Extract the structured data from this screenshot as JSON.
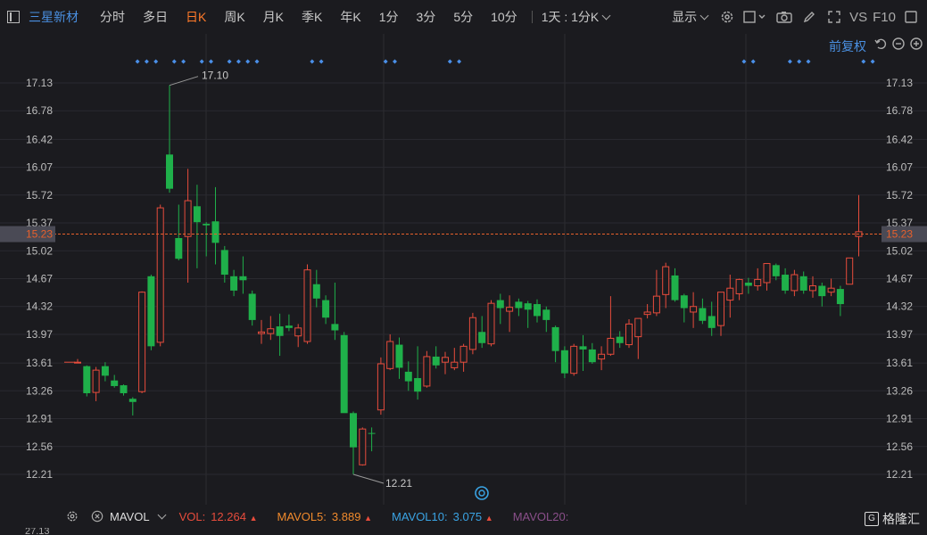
{
  "toolbar": {
    "stock_name": "三星新材",
    "tabs": [
      "分时",
      "多日",
      "日K",
      "周K",
      "月K",
      "季K",
      "年K",
      "1分",
      "3分",
      "5分",
      "10分"
    ],
    "active_tab": "日K",
    "period_select": "1天 : 1分K",
    "display_label": "显示",
    "vs_label": "VS",
    "f10_label": "F10"
  },
  "adjust_label": "前复权",
  "bottom": {
    "indicator": "MAVOL",
    "vol_label": "VOL:",
    "vol_value": "12.264",
    "mavol5_label": "MAVOL5:",
    "mavol5_value": "3.889",
    "mavol10_label": "MAVOL10:",
    "mavol10_value": "3.075",
    "mavol20_label": "MAVOL20:",
    "cut_label": "27.13"
  },
  "brand": "格隆汇",
  "colors": {
    "up": "#e74c3c",
    "down": "#1fb04a",
    "accent": "#ff7a29",
    "link": "#4a90e2",
    "current_price": "#e8602c",
    "mavol5": "#f08a2c",
    "mavol10": "#3aa3e3",
    "mavol20": "#8a4f8a"
  },
  "chart_data": {
    "type": "candlestick",
    "y_ticks": [
      "17.13",
      "16.78",
      "16.42",
      "16.07",
      "15.72",
      "15.37",
      "15.02",
      "14.67",
      "14.32",
      "13.97",
      "13.61",
      "13.26",
      "12.91",
      "12.56",
      "12.21"
    ],
    "ylim": [
      12.06,
      17.43
    ],
    "current_price": "15.23",
    "high_label": "17.10",
    "low_label": "12.21",
    "candles": [
      {
        "o": 13.62,
        "h": 13.66,
        "l": 13.62,
        "c": 13.62
      },
      {
        "o": 13.57,
        "h": 13.58,
        "l": 13.19,
        "c": 13.23
      },
      {
        "o": 13.24,
        "h": 13.56,
        "l": 13.13,
        "c": 13.52
      },
      {
        "o": 13.57,
        "h": 13.62,
        "l": 13.38,
        "c": 13.45
      },
      {
        "o": 13.39,
        "h": 13.46,
        "l": 13.3,
        "c": 13.32
      },
      {
        "o": 13.33,
        "h": 13.34,
        "l": 13.2,
        "c": 13.23
      },
      {
        "o": 13.16,
        "h": 13.18,
        "l": 12.95,
        "c": 13.12
      },
      {
        "o": 13.25,
        "h": 14.51,
        "l": 13.23,
        "c": 14.5
      },
      {
        "o": 14.7,
        "h": 14.72,
        "l": 13.77,
        "c": 13.82
      },
      {
        "o": 13.87,
        "h": 15.6,
        "l": 13.82,
        "c": 15.56
      },
      {
        "o": 16.23,
        "h": 17.1,
        "l": 15.75,
        "c": 15.8
      },
      {
        "o": 15.18,
        "h": 15.6,
        "l": 14.9,
        "c": 14.92
      },
      {
        "o": 15.2,
        "h": 16.05,
        "l": 14.62,
        "c": 15.65
      },
      {
        "o": 15.58,
        "h": 15.85,
        "l": 14.8,
        "c": 15.38
      },
      {
        "o": 15.36,
        "h": 15.38,
        "l": 14.95,
        "c": 15.34
      },
      {
        "o": 15.39,
        "h": 15.82,
        "l": 14.85,
        "c": 15.12
      },
      {
        "o": 15.03,
        "h": 15.08,
        "l": 14.62,
        "c": 14.72
      },
      {
        "o": 14.7,
        "h": 14.78,
        "l": 14.45,
        "c": 14.52
      },
      {
        "o": 14.7,
        "h": 14.95,
        "l": 14.48,
        "c": 14.65
      },
      {
        "o": 14.48,
        "h": 14.52,
        "l": 14.08,
        "c": 14.15
      },
      {
        "o": 13.98,
        "h": 14.15,
        "l": 13.85,
        "c": 14.0
      },
      {
        "o": 13.98,
        "h": 14.2,
        "l": 13.9,
        "c": 14.04
      },
      {
        "o": 14.07,
        "h": 14.23,
        "l": 13.7,
        "c": 13.95
      },
      {
        "o": 14.08,
        "h": 14.22,
        "l": 14.01,
        "c": 14.05
      },
      {
        "o": 13.95,
        "h": 14.1,
        "l": 13.81,
        "c": 14.05
      },
      {
        "o": 13.88,
        "h": 14.85,
        "l": 13.85,
        "c": 14.78
      },
      {
        "o": 14.6,
        "h": 14.78,
        "l": 14.31,
        "c": 14.42
      },
      {
        "o": 14.4,
        "h": 14.46,
        "l": 14.1,
        "c": 14.18
      },
      {
        "o": 14.1,
        "h": 14.62,
        "l": 13.9,
        "c": 14.02
      },
      {
        "o": 13.96,
        "h": 14.0,
        "l": 12.99,
        "c": 12.98
      },
      {
        "o": 12.98,
        "h": 13.0,
        "l": 12.21,
        "c": 12.55
      },
      {
        "o": 12.33,
        "h": 12.8,
        "l": 12.32,
        "c": 12.78
      },
      {
        "o": 12.73,
        "h": 12.8,
        "l": 12.5,
        "c": 12.72
      },
      {
        "o": 13.02,
        "h": 13.68,
        "l": 12.96,
        "c": 13.6
      },
      {
        "o": 13.54,
        "h": 13.97,
        "l": 13.52,
        "c": 13.88
      },
      {
        "o": 13.84,
        "h": 13.93,
        "l": 13.41,
        "c": 13.55
      },
      {
        "o": 13.5,
        "h": 13.63,
        "l": 13.26,
        "c": 13.38
      },
      {
        "o": 13.42,
        "h": 13.82,
        "l": 13.15,
        "c": 13.25
      },
      {
        "o": 13.32,
        "h": 13.76,
        "l": 13.3,
        "c": 13.69
      },
      {
        "o": 13.69,
        "h": 13.82,
        "l": 13.54,
        "c": 13.58
      },
      {
        "o": 13.62,
        "h": 13.75,
        "l": 13.47,
        "c": 13.68
      },
      {
        "o": 13.55,
        "h": 13.8,
        "l": 13.52,
        "c": 13.62
      },
      {
        "o": 13.62,
        "h": 13.85,
        "l": 13.5,
        "c": 13.82
      },
      {
        "o": 13.78,
        "h": 14.24,
        "l": 13.72,
        "c": 14.18
      },
      {
        "o": 14.0,
        "h": 14.2,
        "l": 13.8,
        "c": 13.86
      },
      {
        "o": 13.85,
        "h": 14.4,
        "l": 13.82,
        "c": 14.36
      },
      {
        "o": 14.4,
        "h": 14.48,
        "l": 14.1,
        "c": 14.3
      },
      {
        "o": 14.26,
        "h": 14.46,
        "l": 14.0,
        "c": 14.31
      },
      {
        "o": 14.38,
        "h": 14.42,
        "l": 14.2,
        "c": 14.3
      },
      {
        "o": 14.36,
        "h": 14.39,
        "l": 14.05,
        "c": 14.28
      },
      {
        "o": 14.35,
        "h": 14.41,
        "l": 14.12,
        "c": 14.2
      },
      {
        "o": 14.28,
        "h": 14.32,
        "l": 14.0,
        "c": 14.15
      },
      {
        "o": 14.06,
        "h": 14.08,
        "l": 13.62,
        "c": 13.76
      },
      {
        "o": 13.77,
        "h": 13.82,
        "l": 13.42,
        "c": 13.48
      },
      {
        "o": 13.48,
        "h": 13.85,
        "l": 13.45,
        "c": 13.82
      },
      {
        "o": 13.82,
        "h": 13.96,
        "l": 13.51,
        "c": 13.78
      },
      {
        "o": 13.78,
        "h": 13.86,
        "l": 13.6,
        "c": 13.62
      },
      {
        "o": 13.66,
        "h": 13.82,
        "l": 13.52,
        "c": 13.72
      },
      {
        "o": 13.72,
        "h": 14.45,
        "l": 13.7,
        "c": 13.92
      },
      {
        "o": 13.94,
        "h": 14.01,
        "l": 13.8,
        "c": 13.86
      },
      {
        "o": 13.84,
        "h": 14.16,
        "l": 13.8,
        "c": 14.1
      },
      {
        "o": 13.94,
        "h": 14.1,
        "l": 13.66,
        "c": 14.17
      },
      {
        "o": 14.22,
        "h": 14.35,
        "l": 14.17,
        "c": 14.25
      },
      {
        "o": 14.24,
        "h": 14.78,
        "l": 14.2,
        "c": 14.45
      },
      {
        "o": 14.47,
        "h": 14.87,
        "l": 14.3,
        "c": 14.82
      },
      {
        "o": 14.71,
        "h": 14.8,
        "l": 14.38,
        "c": 14.4
      },
      {
        "o": 14.46,
        "h": 14.48,
        "l": 14.12,
        "c": 14.3
      },
      {
        "o": 14.25,
        "h": 14.5,
        "l": 14.05,
        "c": 14.32
      },
      {
        "o": 14.3,
        "h": 14.42,
        "l": 14.1,
        "c": 14.14
      },
      {
        "o": 14.2,
        "h": 14.38,
        "l": 13.95,
        "c": 14.05
      },
      {
        "o": 14.08,
        "h": 14.48,
        "l": 13.95,
        "c": 14.5
      },
      {
        "o": 14.4,
        "h": 14.72,
        "l": 14.18,
        "c": 14.55
      },
      {
        "o": 14.48,
        "h": 14.67,
        "l": 14.4,
        "c": 14.66
      },
      {
        "o": 14.62,
        "h": 14.68,
        "l": 14.48,
        "c": 14.58
      },
      {
        "o": 14.58,
        "h": 14.8,
        "l": 14.52,
        "c": 14.66
      },
      {
        "o": 14.62,
        "h": 14.86,
        "l": 14.52,
        "c": 14.86
      },
      {
        "o": 14.84,
        "h": 14.86,
        "l": 14.65,
        "c": 14.7
      },
      {
        "o": 14.72,
        "h": 14.8,
        "l": 14.48,
        "c": 14.52
      },
      {
        "o": 14.52,
        "h": 14.78,
        "l": 14.45,
        "c": 14.72
      },
      {
        "o": 14.7,
        "h": 14.76,
        "l": 14.48,
        "c": 14.52
      },
      {
        "o": 14.52,
        "h": 14.7,
        "l": 14.43,
        "c": 14.58
      },
      {
        "o": 14.58,
        "h": 14.62,
        "l": 14.32,
        "c": 14.45
      },
      {
        "o": 14.5,
        "h": 14.67,
        "l": 14.45,
        "c": 14.55
      },
      {
        "o": 14.54,
        "h": 14.58,
        "l": 14.2,
        "c": 14.35
      },
      {
        "o": 14.6,
        "h": 14.63,
        "l": 14.62,
        "c": 14.93
      },
      {
        "o": 15.2,
        "h": 15.72,
        "l": 14.95,
        "c": 15.26
      }
    ],
    "event_marker_indices": [
      7,
      8,
      9,
      11,
      12,
      14,
      15,
      17,
      18,
      19,
      20,
      26,
      27,
      34,
      35,
      41,
      42,
      73,
      74,
      78,
      79,
      80,
      86,
      87
    ]
  }
}
